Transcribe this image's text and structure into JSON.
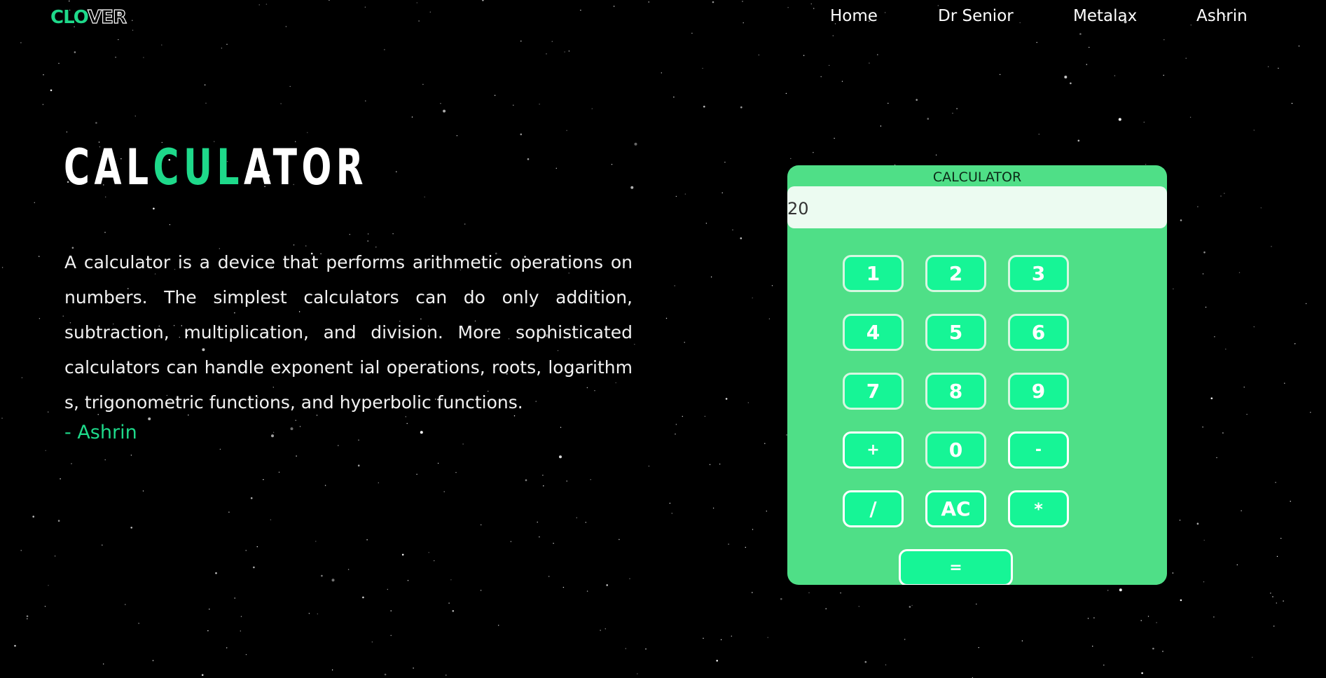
{
  "brand": {
    "logo_accent": "CLO",
    "logo_rest": "VER",
    "accent_color": "#1ed98a"
  },
  "nav": {
    "items": [
      "Home",
      "Dr Senior",
      "Metalax",
      "Ashrin"
    ]
  },
  "hero": {
    "title_start": "CAL",
    "title_mid": "CUL",
    "title_end": "ATOR",
    "description": "A calculator is a device that performs arithmetic operations on numbers. The simplest calculators can do only addition, subtraction, multiplication, and division. More sophisticated calculators can handle exponent ial operations, roots, logarithm s, trigonometric functions, and hyperbolic functions.",
    "author": "- Ashrin"
  },
  "calculator": {
    "title": "CALCULATOR",
    "display_value": "20",
    "panel_color": "#4fdf87",
    "key_color": "#16f596",
    "keys": {
      "k1": "1",
      "k2": "2",
      "k3": "3",
      "k4": "4",
      "k5": "5",
      "k6": "6",
      "k7": "7",
      "k8": "8",
      "k9": "9",
      "plus": "+",
      "k0": "0",
      "minus": "-",
      "divide": "/",
      "clear": "AC",
      "multiply": "*",
      "equals": "="
    }
  }
}
